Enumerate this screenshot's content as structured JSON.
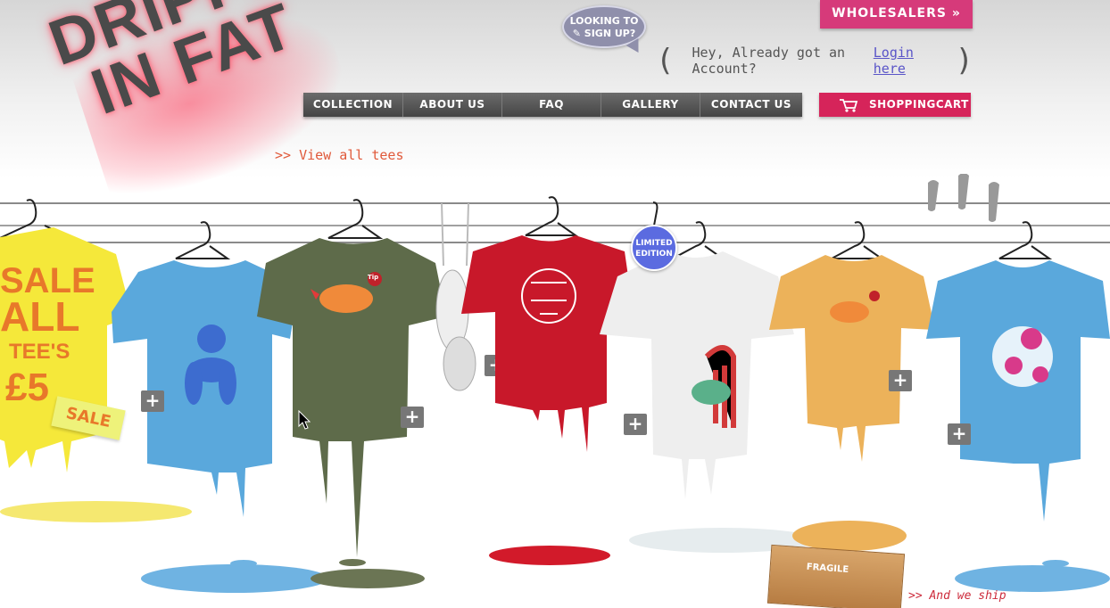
{
  "brand": {
    "logo_line1": "DRIPPING",
    "logo_line2": "IN FAT"
  },
  "signup_bubble": {
    "line1": "LOOKING TO",
    "line2": "SIGN UP?"
  },
  "wholesalers": {
    "label": "WHOLESALERS",
    "arrow": "»"
  },
  "account": {
    "message": "Hey, Already got an Account?",
    "login_link": "Login here"
  },
  "nav": {
    "items": [
      {
        "label": "COLLECTION"
      },
      {
        "label": "ABOUT US"
      },
      {
        "label": "FAQ"
      },
      {
        "label": "GALLERY"
      },
      {
        "label": "CONTACT US"
      }
    ]
  },
  "cart": {
    "label": "SHOPPINGCART",
    "icon": "cart-icon"
  },
  "view_all": {
    "arrow": ">>",
    "label": "View all tees"
  },
  "sale_shirt": {
    "line1": "SALE",
    "line2": "ALL",
    "line3": "TEE'S",
    "line4": "£5",
    "tag": "SALE"
  },
  "limited_badge": {
    "line1": "LIMITED",
    "line2": "EDITION"
  },
  "shirt_tag": "Tip",
  "plus_label": "+",
  "ship": {
    "text": ">> And we ship",
    "box_label": "FRAGILE"
  },
  "colors": {
    "pink": "#d6245a",
    "nav": "#555555",
    "yellow": "#f5e83a",
    "blue": "#5aa8dc",
    "olive": "#5e6b4a",
    "red": "#c8182a",
    "white": "#eeeeee",
    "mustard": "#ecb25a",
    "link": "#5a55c8",
    "accent_orange": "#e0593a"
  }
}
